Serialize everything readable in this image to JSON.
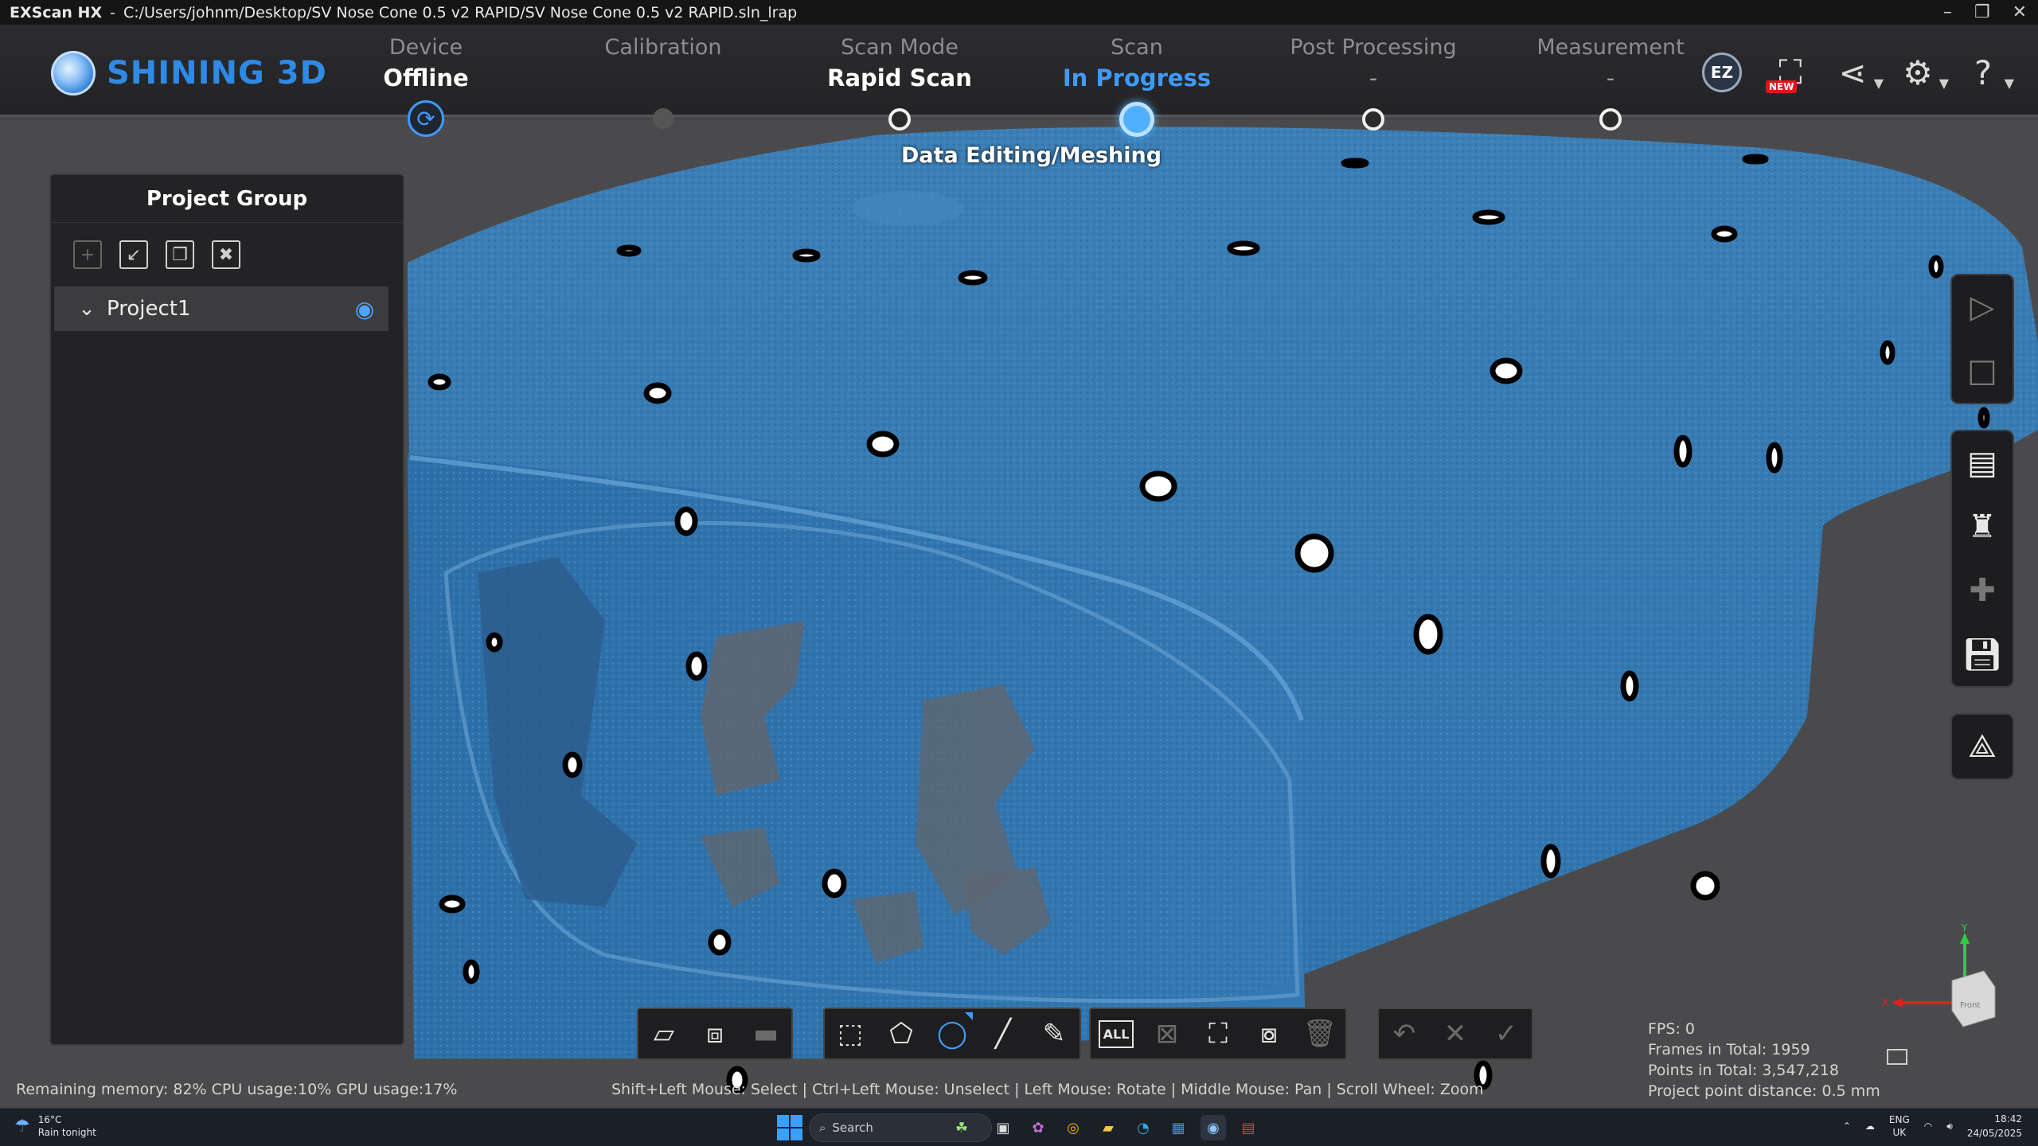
{
  "titlebar": {
    "app": "EXScan HX",
    "separator": "-",
    "path": "C:/Users/johnm/Desktop/SV Nose Cone 0.5 v2 RAPID/SV Nose Cone 0.5 v2 RAPID.sln_lrap"
  },
  "brand": "SHINING 3D",
  "steps": [
    {
      "label": "Device",
      "value": "Offline"
    },
    {
      "label": "Calibration",
      "value": ""
    },
    {
      "label": "Scan Mode",
      "value": "Rapid Scan"
    },
    {
      "label": "Scan",
      "value": "In Progress"
    },
    {
      "label": "Post Processing",
      "value": "-"
    },
    {
      "label": "Measurement",
      "value": "-"
    }
  ],
  "subtitle": "Data Editing/Meshing",
  "header_icons": {
    "ez": "EZ",
    "new_badge": "NEW"
  },
  "panel": {
    "title": "Project Group",
    "project": "Project1"
  },
  "status": {
    "left": "Remaining memory: 82% CPU usage:10%  GPU usage:17%",
    "hint": "Shift+Left Mouse: Select | Ctrl+Left Mouse: Unselect | Left Mouse: Rotate | Middle Mouse: Pan | Scroll Wheel: Zoom",
    "fps": "FPS:  0",
    "frames": "Frames in Total: 1959",
    "points": "Points in Total: 3,547,218",
    "distance": "Project point distance: 0.5 mm"
  },
  "toolbar": {
    "all_label": "ALL"
  },
  "axes": {
    "x": "X",
    "y": "Y",
    "cube_face": "Front"
  },
  "taskbar": {
    "temp": "16°C",
    "weather": "Rain tonight",
    "search": "Search",
    "lang": "ENG",
    "region": "UK",
    "time": "18:42",
    "date": "24/05/2025"
  }
}
